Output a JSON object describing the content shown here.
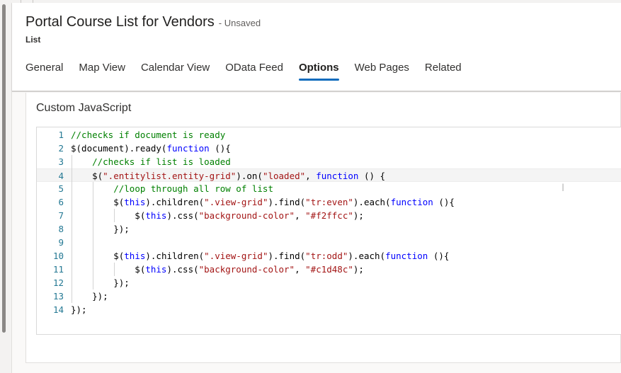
{
  "header": {
    "title": "Portal Course List for Vendors",
    "status": "- Unsaved",
    "entity_type": "List"
  },
  "tabs": [
    {
      "label": "General",
      "active": false
    },
    {
      "label": "Map View",
      "active": false
    },
    {
      "label": "Calendar View",
      "active": false
    },
    {
      "label": "OData Feed",
      "active": false
    },
    {
      "label": "Options",
      "active": true
    },
    {
      "label": "Web Pages",
      "active": false
    },
    {
      "label": "Related",
      "active": false
    }
  ],
  "section": {
    "title": "Custom JavaScript"
  },
  "editor": {
    "current_line": 4,
    "lines": [
      {
        "num": "1",
        "tokens": [
          {
            "c": "com",
            "t": "//checks if document is ready"
          }
        ]
      },
      {
        "num": "2",
        "tokens": [
          {
            "c": "plain",
            "t": "$(document).ready("
          },
          {
            "c": "kw",
            "t": "function"
          },
          {
            "c": "plain",
            "t": " (){"
          }
        ]
      },
      {
        "num": "3",
        "tokens": [
          {
            "c": "plain",
            "t": "    "
          },
          {
            "c": "com",
            "t": "//checks if list is loaded"
          }
        ]
      },
      {
        "num": "4",
        "tokens": [
          {
            "c": "plain",
            "t": "    $("
          },
          {
            "c": "str",
            "t": "\".entitylist.entity-grid\""
          },
          {
            "c": "plain",
            "t": ").on("
          },
          {
            "c": "str",
            "t": "\"loaded\""
          },
          {
            "c": "plain",
            "t": ", "
          },
          {
            "c": "kw",
            "t": "function"
          },
          {
            "c": "plain",
            "t": " () {"
          }
        ]
      },
      {
        "num": "5",
        "tokens": [
          {
            "c": "plain",
            "t": "        "
          },
          {
            "c": "com",
            "t": "//loop through all row of list"
          }
        ]
      },
      {
        "num": "6",
        "tokens": [
          {
            "c": "plain",
            "t": "        $("
          },
          {
            "c": "kw",
            "t": "this"
          },
          {
            "c": "plain",
            "t": ").children("
          },
          {
            "c": "str",
            "t": "\".view-grid\""
          },
          {
            "c": "plain",
            "t": ").find("
          },
          {
            "c": "str",
            "t": "\"tr:even\""
          },
          {
            "c": "plain",
            "t": ").each("
          },
          {
            "c": "kw",
            "t": "function"
          },
          {
            "c": "plain",
            "t": " (){"
          }
        ]
      },
      {
        "num": "7",
        "tokens": [
          {
            "c": "plain",
            "t": "            $("
          },
          {
            "c": "kw",
            "t": "this"
          },
          {
            "c": "plain",
            "t": ").css("
          },
          {
            "c": "str",
            "t": "\"background-color\""
          },
          {
            "c": "plain",
            "t": ", "
          },
          {
            "c": "str",
            "t": "\"#f2ffcc\""
          },
          {
            "c": "plain",
            "t": ");"
          }
        ]
      },
      {
        "num": "8",
        "tokens": [
          {
            "c": "plain",
            "t": "        });"
          }
        ]
      },
      {
        "num": "9",
        "tokens": [
          {
            "c": "plain",
            "t": ""
          }
        ]
      },
      {
        "num": "10",
        "tokens": [
          {
            "c": "plain",
            "t": "        $("
          },
          {
            "c": "kw",
            "t": "this"
          },
          {
            "c": "plain",
            "t": ").children("
          },
          {
            "c": "str",
            "t": "\".view-grid\""
          },
          {
            "c": "plain",
            "t": ").find("
          },
          {
            "c": "str",
            "t": "\"tr:odd\""
          },
          {
            "c": "plain",
            "t": ").each("
          },
          {
            "c": "kw",
            "t": "function"
          },
          {
            "c": "plain",
            "t": " (){"
          }
        ]
      },
      {
        "num": "11",
        "tokens": [
          {
            "c": "plain",
            "t": "            $("
          },
          {
            "c": "kw",
            "t": "this"
          },
          {
            "c": "plain",
            "t": ").css("
          },
          {
            "c": "str",
            "t": "\"background-color\""
          },
          {
            "c": "plain",
            "t": ", "
          },
          {
            "c": "str",
            "t": "\"#c1d48c\""
          },
          {
            "c": "plain",
            "t": ");"
          }
        ]
      },
      {
        "num": "12",
        "tokens": [
          {
            "c": "plain",
            "t": "        });"
          }
        ]
      },
      {
        "num": "13",
        "tokens": [
          {
            "c": "plain",
            "t": "    });"
          }
        ]
      },
      {
        "num": "14",
        "tokens": [
          {
            "c": "plain",
            "t": "});"
          }
        ]
      }
    ]
  },
  "colors": {
    "accent": "#0f6cbd",
    "comment": "#008000",
    "string": "#a31515",
    "keyword": "#0000ff",
    "line_number": "#237893"
  }
}
